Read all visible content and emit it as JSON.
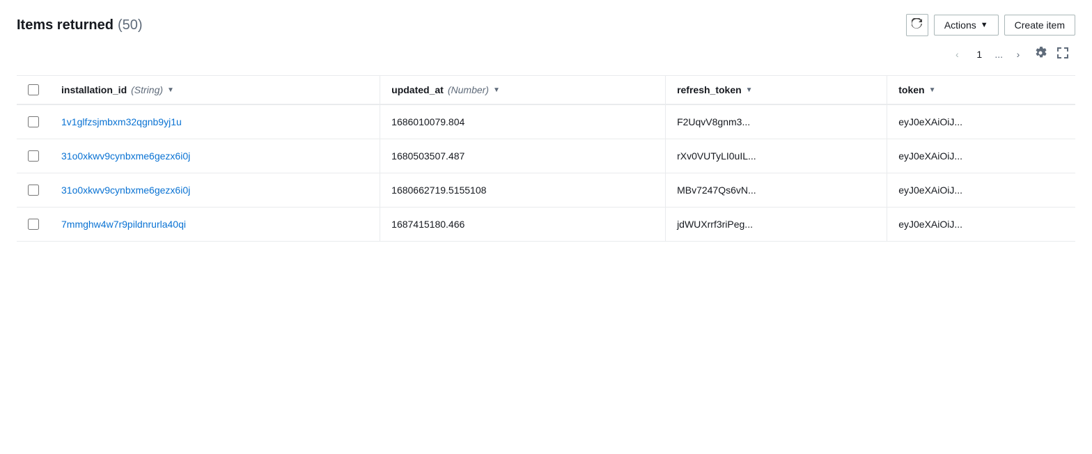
{
  "header": {
    "title": "Items returned",
    "count": "(50)",
    "refresh_label": "↺",
    "actions_label": "Actions",
    "create_item_label": "Create item"
  },
  "pagination": {
    "prev_label": "‹",
    "current_page": "1",
    "ellipsis": "...",
    "next_label": "›",
    "settings_icon": "⚙",
    "expand_icon": "⛶"
  },
  "columns": [
    {
      "id": "installation_id",
      "label": "installation_id",
      "type": "String",
      "sortable": true
    },
    {
      "id": "updated_at",
      "label": "updated_at",
      "type": "Number",
      "sortable": true
    },
    {
      "id": "refresh_token",
      "label": "refresh_token",
      "type": null,
      "sortable": true
    },
    {
      "id": "token",
      "label": "token",
      "type": null,
      "sortable": true
    }
  ],
  "rows": [
    {
      "installation_id": "1v1glfzsjmbxm32qgnb9yj1u",
      "updated_at": "1686010079.804",
      "refresh_token": "F2UqvV8gnm3...",
      "token": "eyJ0eXAiOiJ..."
    },
    {
      "installation_id": "31o0xkwv9cynbxme6gezx6i0j",
      "updated_at": "1680503507.487",
      "refresh_token": "rXv0VUTyLI0uIL...",
      "token": "eyJ0eXAiOiJ..."
    },
    {
      "installation_id": "31o0xkwv9cynbxme6gezx6i0j",
      "updated_at": "1680662719.5155108",
      "refresh_token": "MBv7247Qs6vN...",
      "token": "eyJ0eXAiOiJ..."
    },
    {
      "installation_id": "7mmghw4w7r9pildnrurla40qi",
      "updated_at": "1687415180.466",
      "refresh_token": "jdWUXrrf3riPeg...",
      "token": "eyJ0eXAiOiJ..."
    }
  ]
}
